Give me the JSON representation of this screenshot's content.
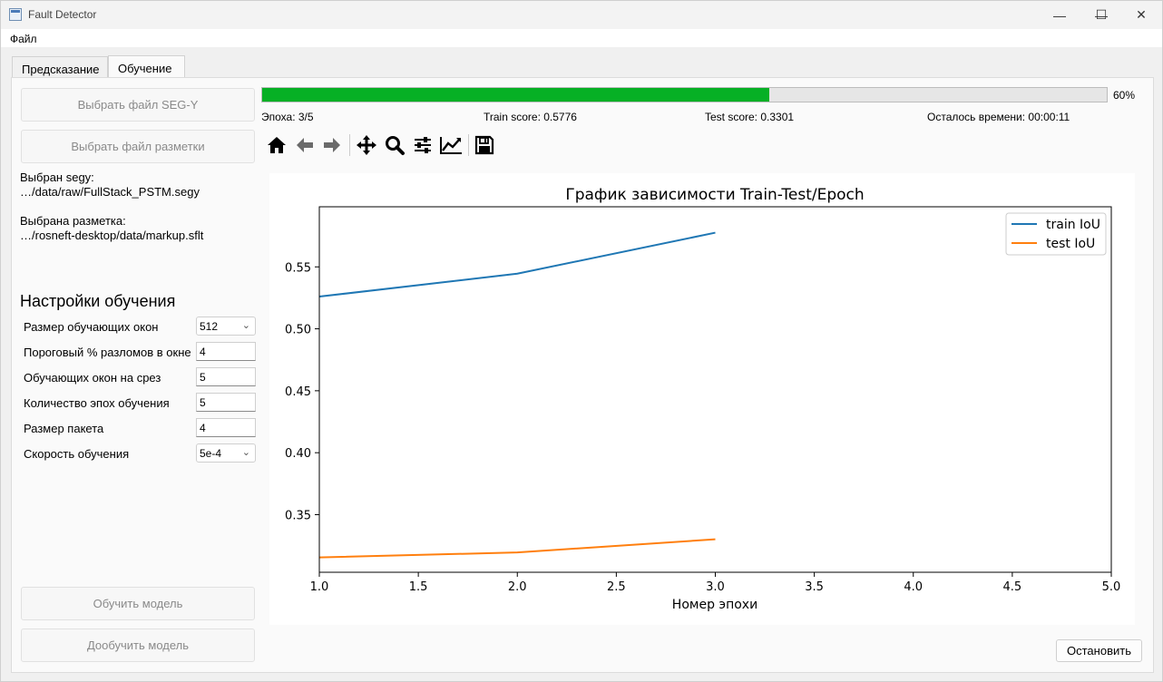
{
  "window": {
    "title": "Fault Detector",
    "minimize_glyph": "—",
    "maximize_glyph": "☐",
    "close_glyph": "✕"
  },
  "menu": {
    "file": "Файл"
  },
  "tabs": [
    {
      "label": "Предсказание",
      "active": false
    },
    {
      "label": "Обучение",
      "active": true
    }
  ],
  "left_panel": {
    "select_segy_button": "Выбрать файл SEG-Y",
    "select_markup_button": "Выбрать файл разметки",
    "segy_label": "Выбран segy:",
    "segy_path": "…/data/raw/FullStack_PSTM.segy",
    "markup_label": "Выбрана разметка:",
    "markup_path": "…/rosneft-desktop/data/markup.sflt",
    "settings_title": "Настройки обучения",
    "settings": [
      {
        "label": "Размер обучающих окон",
        "value": "512",
        "kind": "select"
      },
      {
        "label": "Пороговый % разломов в окне",
        "value": "4",
        "kind": "input"
      },
      {
        "label": "Обучающих окон на срез",
        "value": "5",
        "kind": "input"
      },
      {
        "label": "Количество эпох обучения",
        "value": "5",
        "kind": "input"
      },
      {
        "label": "Размер пакета",
        "value": "4",
        "kind": "input"
      },
      {
        "label": "Скорость обучения",
        "value": "5e-4",
        "kind": "select"
      }
    ],
    "train_button": "Обучить модель",
    "retrain_button": "Дообучить модель"
  },
  "progress": {
    "value": 60,
    "label": "60%",
    "epoch": "Эпоха: 3/5",
    "train_score": "Train score: 0.5776",
    "test_score": "Test score: 0.3301",
    "time_left": "Осталось времени: 00:00:11",
    "fill_color": "#06b025"
  },
  "toolbar": {
    "icons": [
      "home-icon",
      "back-arrow-icon",
      "forward-arrow-icon",
      "pan-icon",
      "zoom-icon",
      "subplots-config-icon",
      "edit-axes-icon",
      "save-icon"
    ]
  },
  "stop_button": "Остановить",
  "chart_data": {
    "type": "line",
    "title": "График зависимости Train-Test/Epoch",
    "xlabel": "Номер эпохи",
    "ylabel": "",
    "xlim": [
      1.0,
      5.0
    ],
    "ylim": [
      0.3035,
      0.5985
    ],
    "xticks": [
      "1.0",
      "1.5",
      "2.0",
      "2.5",
      "3.0",
      "3.5",
      "4.0",
      "4.5",
      "5.0"
    ],
    "yticks": [
      "0.35",
      "0.40",
      "0.45",
      "0.50",
      "0.55"
    ],
    "grid": false,
    "legend_position": "top-right",
    "series": [
      {
        "name": "train IoU",
        "color": "#1f77b4",
        "x": [
          1,
          2,
          3
        ],
        "y": [
          0.526,
          0.5445,
          0.5776
        ]
      },
      {
        "name": "test IoU",
        "color": "#ff7f0e",
        "x": [
          1,
          2,
          3
        ],
        "y": [
          0.3155,
          0.3195,
          0.3301
        ]
      }
    ]
  }
}
